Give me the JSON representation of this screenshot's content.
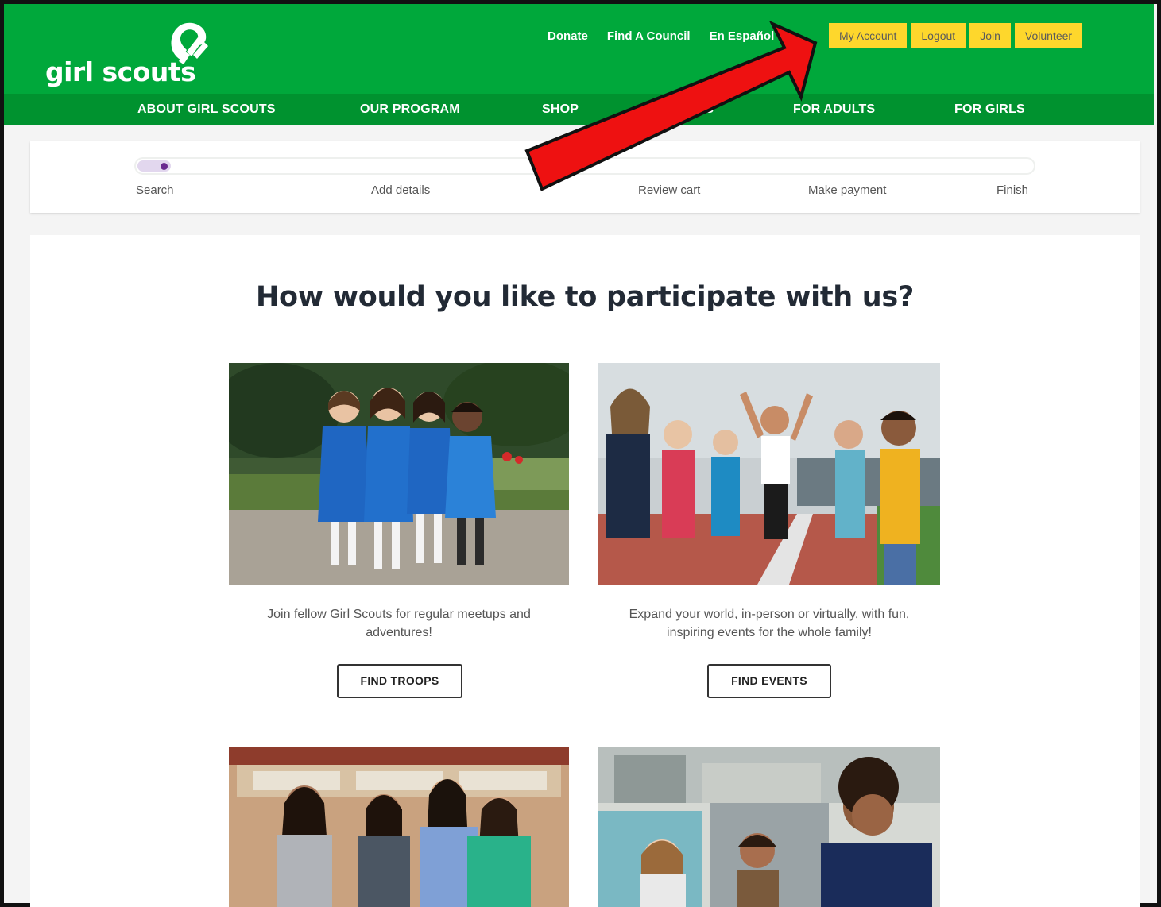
{
  "brand": {
    "name": "girl scouts"
  },
  "colors": {
    "brand_green": "#00a83b",
    "nav_green": "#00922f",
    "accent_yellow": "#fed72c",
    "progress_purple": "#6b2b90",
    "arrow_red": "#ee1111"
  },
  "header": {
    "utility_links": [
      {
        "label": "Donate"
      },
      {
        "label": "Find A Council"
      },
      {
        "label": "En Español"
      }
    ],
    "account_buttons": [
      {
        "label": "My Account"
      },
      {
        "label": "Logout"
      },
      {
        "label": "Join"
      },
      {
        "label": "Volunteer"
      }
    ]
  },
  "nav": {
    "items": [
      {
        "label": "ABOUT GIRL SCOUTS"
      },
      {
        "label": "OUR PROGRAM"
      },
      {
        "label": "SHOP"
      },
      {
        "label": "EVENTS"
      },
      {
        "label": "FOR ADULTS"
      },
      {
        "label": "FOR GIRLS"
      }
    ]
  },
  "progress": {
    "current_step": 1,
    "steps": [
      {
        "label": "Search"
      },
      {
        "label": "Add details"
      },
      {
        "label": "Review cart"
      },
      {
        "label": "Make payment"
      },
      {
        "label": "Finish"
      }
    ]
  },
  "main": {
    "headline": "How would you like to participate with us?",
    "cards": [
      {
        "image_icon": "troop-photo-icon",
        "description": "Join fellow Girl Scouts for regular meetups and adventures!",
        "button": "FIND TROOPS"
      },
      {
        "image_icon": "events-photo-icon",
        "description": "Expand your world, in-person or virtually, with fun, inspiring events for the whole family!",
        "button": "FIND EVENTS"
      },
      {
        "image_icon": "teens-photo-icon"
      },
      {
        "image_icon": "volunteer-photo-icon"
      }
    ]
  },
  "annotation": {
    "icon": "red-arrow-icon",
    "points_to": "My Account"
  }
}
